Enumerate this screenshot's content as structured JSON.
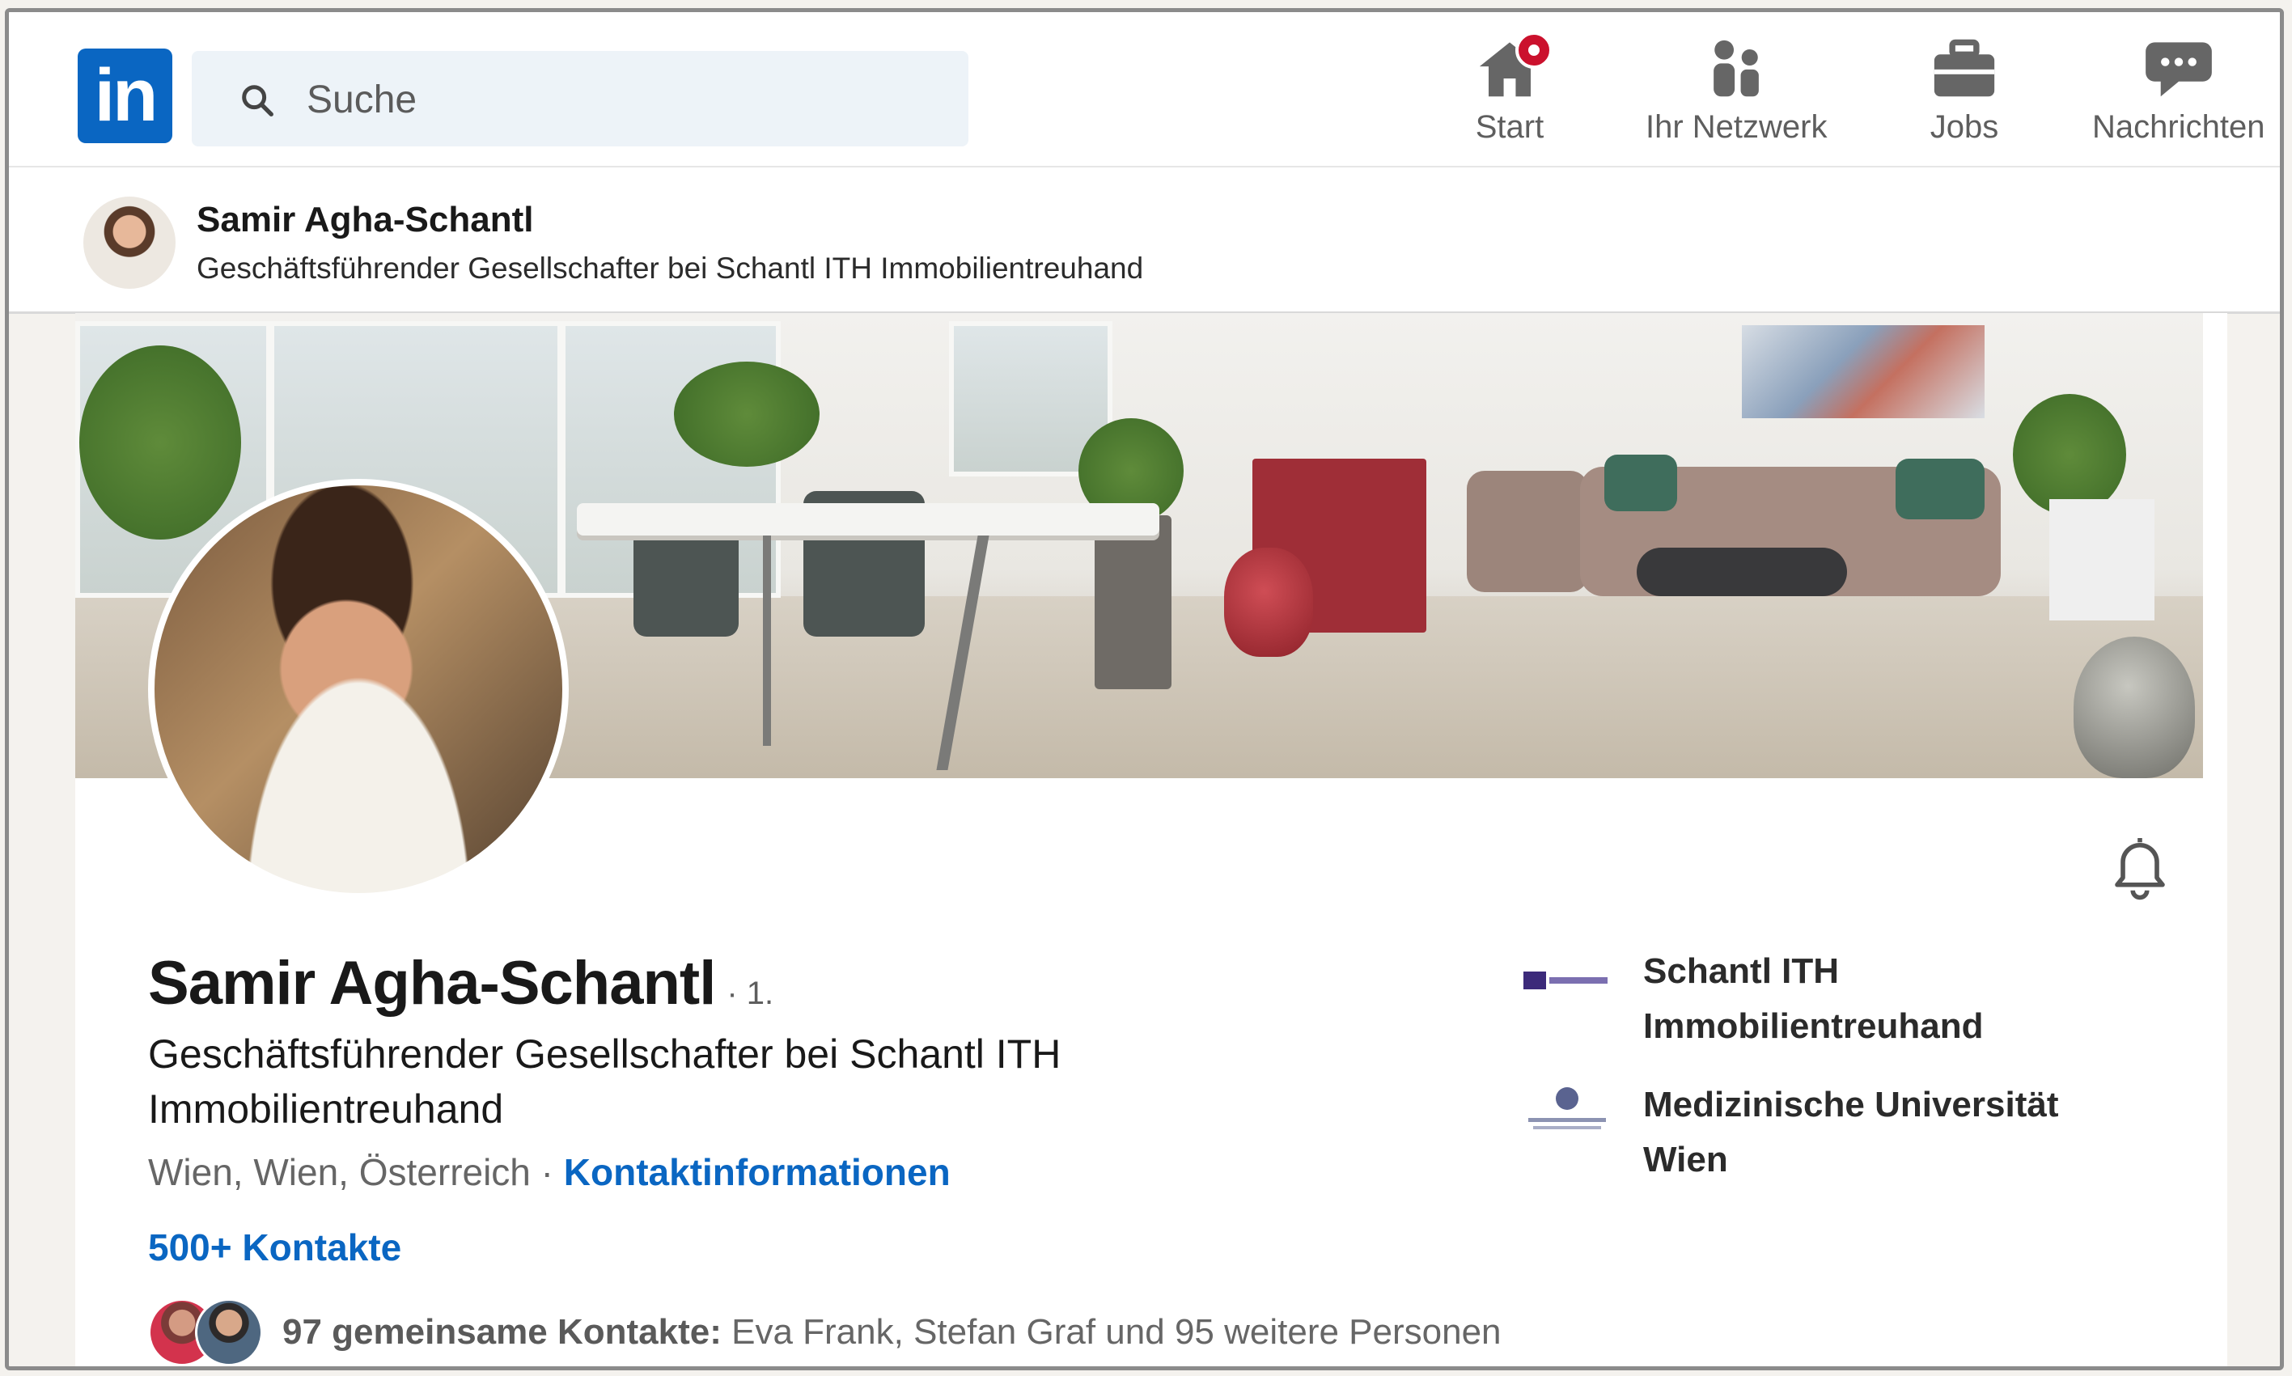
{
  "nav": {
    "logo_text": "in",
    "search_placeholder": "Suche",
    "items": [
      {
        "label": "Start",
        "icon": "home-icon"
      },
      {
        "label": "Ihr Netzwerk",
        "icon": "network-icon"
      },
      {
        "label": "Jobs",
        "icon": "briefcase-icon"
      },
      {
        "label": "Nachrichten",
        "icon": "messaging-icon"
      }
    ]
  },
  "sticky_header": {
    "name": "Samir Agha-Schantl",
    "headline": "Geschäftsführender Gesellschafter bei Schantl ITH Immobilientreuhand"
  },
  "profile": {
    "name": "Samir Agha-Schantl",
    "degree": "· 1.",
    "headline": "Geschäftsführender Gesellschafter bei Schantl ITH Immobilientreuhand",
    "location": "Wien, Wien, Österreich",
    "location_separator": " · ",
    "contact_info_link": "Kontaktinformationen",
    "connections": "500+ Kontakte",
    "mutual_label": "97 gemeinsame Kontakte:",
    "mutual_names": "Eva Frank, Stefan Graf und 95 weitere Personen",
    "affiliations": [
      {
        "name": "Schantl ITH Immobilientreuhand",
        "icon": "company-logo"
      },
      {
        "name": "Medizinische Universität Wien",
        "icon": "university-logo"
      }
    ]
  },
  "colors": {
    "brand": "#0a66c2",
    "notification": "#cb112d"
  }
}
